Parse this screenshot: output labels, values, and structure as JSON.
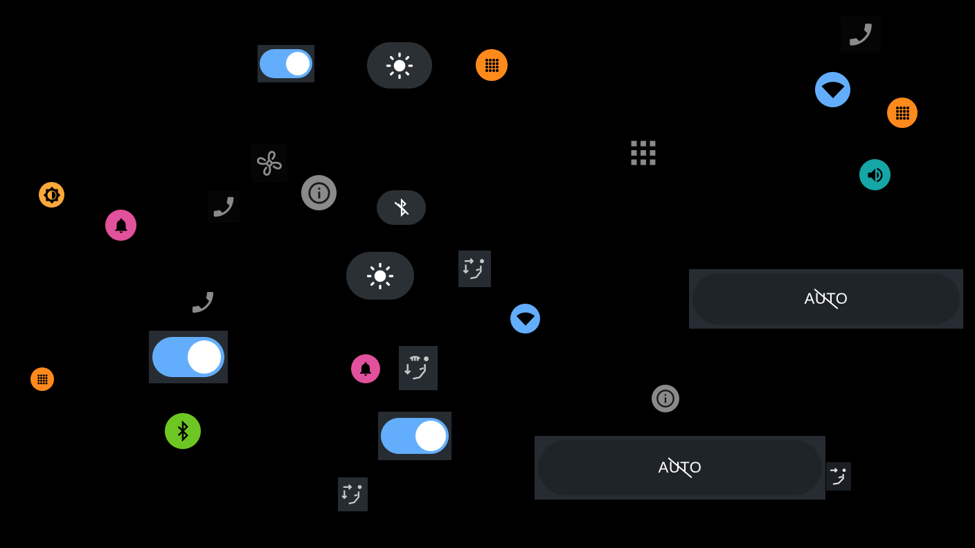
{
  "colors": {
    "background": "#000000",
    "toggle_on": "#63aefc",
    "tile_bg": "#272c32",
    "orange": "#ff8a1c",
    "amber": "#fba83a",
    "pink": "#e2519b",
    "blue": "#63aefc",
    "teal": "#15a6a6",
    "green": "#6ec623",
    "gray_icon": "#8a8a8a"
  },
  "controls": {
    "auto_button_1": {
      "label": "AUTO",
      "state": "off"
    },
    "auto_button_2": {
      "label": "AUTO",
      "state": "off"
    },
    "toggles": [
      {
        "state": "on"
      },
      {
        "state": "on"
      },
      {
        "state": "on"
      }
    ]
  },
  "icons": [
    "toggle-switch",
    "brightness-icon",
    "app-grid-icon",
    "phone-icon",
    "wifi-icon",
    "app-grid-icon",
    "grid-icon",
    "volume-icon",
    "fan-icon",
    "info-icon",
    "bluetooth-off-icon",
    "brightness-auto-icon",
    "notification-bell-icon",
    "seat-adjust-icon",
    "seat-heat-icon",
    "bluetooth-icon"
  ]
}
